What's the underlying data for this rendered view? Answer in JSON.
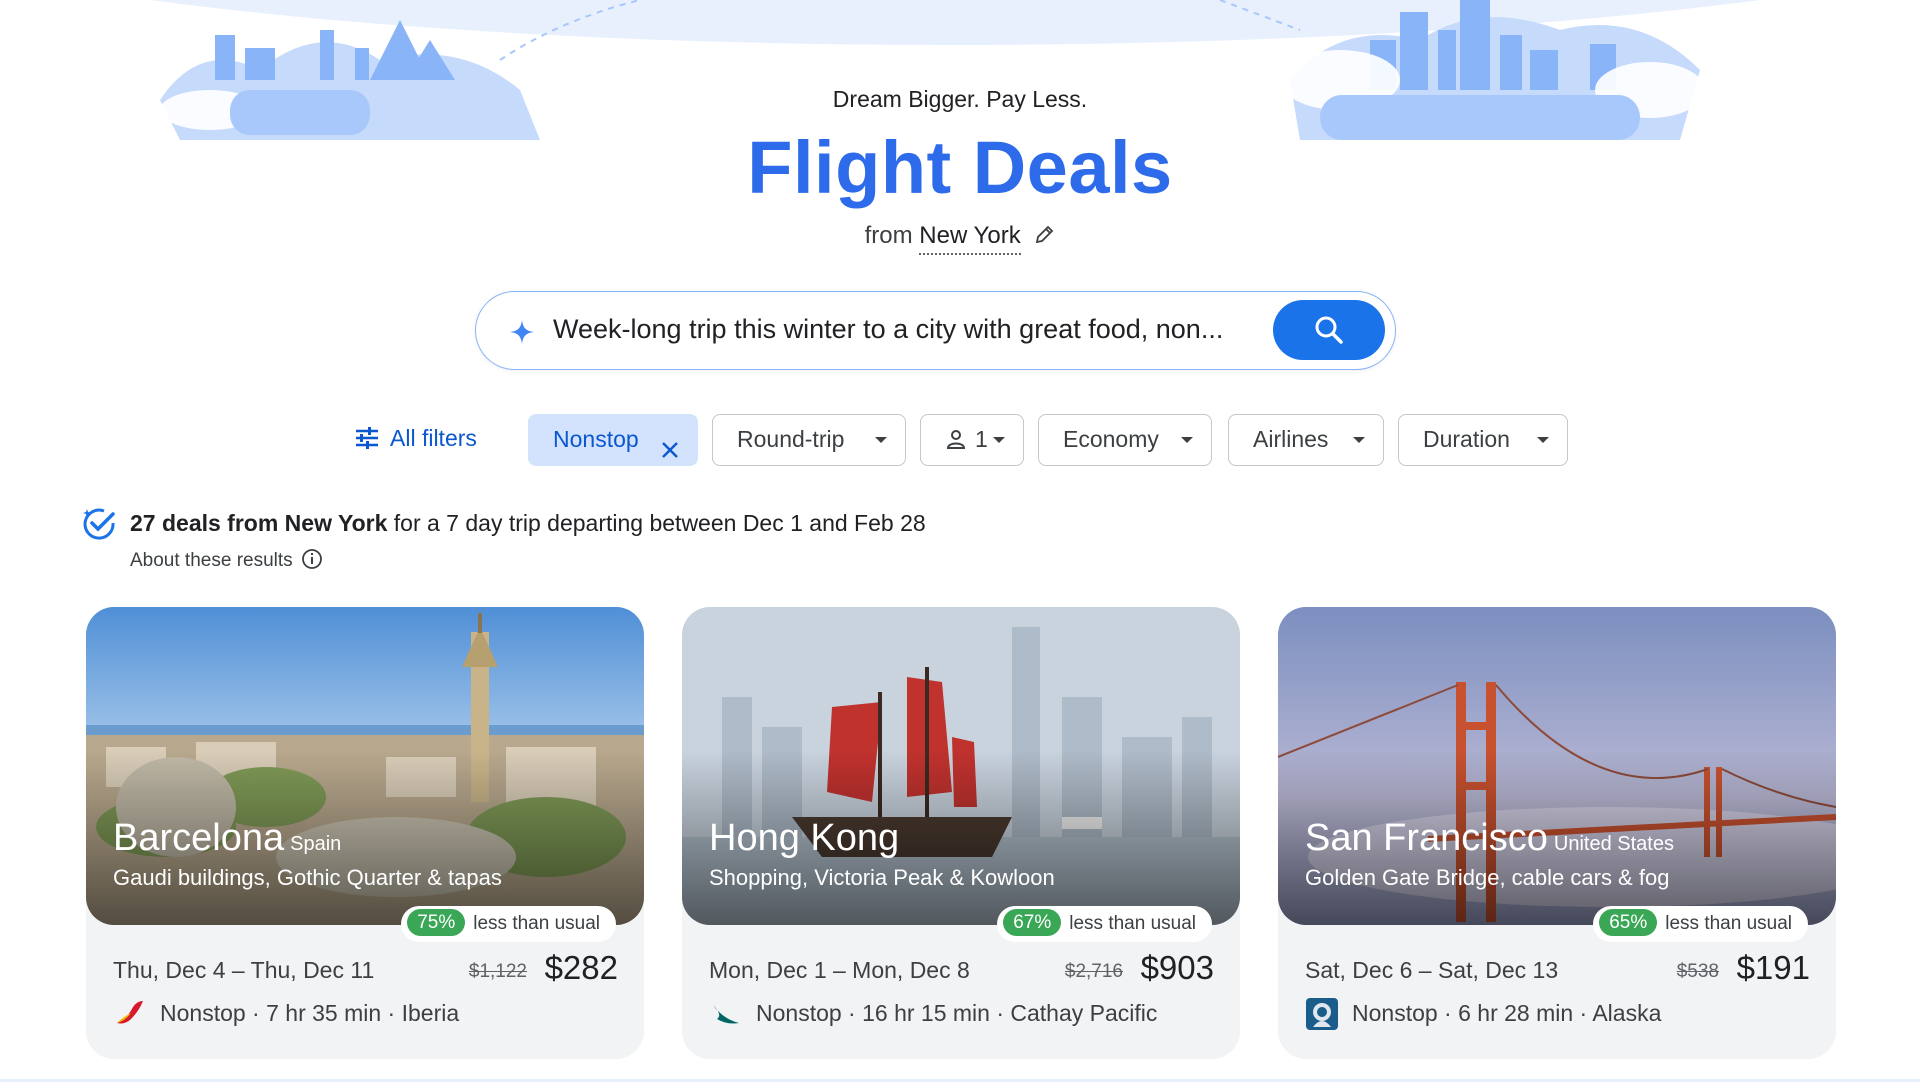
{
  "hero": {
    "tagline": "Dream Bigger. Pay Less.",
    "title": "Flight Deals",
    "from_prefix": "from",
    "from_city": "New York"
  },
  "search": {
    "query": "Week-long trip this winter to a city with great food, non..."
  },
  "filters": {
    "all_filters": "All filters",
    "nonstop": "Nonstop",
    "trip_type": "Round-trip",
    "passengers": "1",
    "cabin": "Economy",
    "airlines": "Airlines",
    "duration": "Duration"
  },
  "summary": {
    "bold": "27 deals from New York",
    "rest": "for a 7 day trip departing between Dec 1 and Feb 28",
    "about": "About these results"
  },
  "deals": [
    {
      "city": "Barcelona",
      "country": "Spain",
      "description": "Gaudi buildings, Gothic Quarter & tapas",
      "discount": "75%",
      "discount_label": "less than usual",
      "dates": "Thu, Dec 4 – Thu, Dec 11",
      "old_price": "$1,122",
      "price": "$282",
      "flight": "Nonstop · 7 hr 35 min · Iberia",
      "airline_icon": "iberia-logo-icon"
    },
    {
      "city": "Hong Kong",
      "country": "",
      "description": "Shopping, Victoria Peak & Kowloon",
      "discount": "67%",
      "discount_label": "less than usual",
      "dates": "Mon, Dec 1 – Mon, Dec 8",
      "old_price": "$2,716",
      "price": "$903",
      "flight": "Nonstop · 16 hr 15 min · Cathay Pacific",
      "airline_icon": "cathay-pacific-logo-icon"
    },
    {
      "city": "San Francisco",
      "country": "United States",
      "description": "Golden Gate Bridge, cable cars & fog",
      "discount": "65%",
      "discount_label": "less than usual",
      "dates": "Sat, Dec 6 – Sat, Dec 13",
      "old_price": "$538",
      "price": "$191",
      "flight": "Nonstop · 6 hr 28 min · Alaska",
      "airline_icon": "alaska-logo-icon"
    }
  ],
  "colors": {
    "brand_blue": "#2e6bea",
    "search_button": "#1a73e8",
    "chip_active_bg": "#d3e3fd",
    "discount_green": "#3aa757"
  }
}
